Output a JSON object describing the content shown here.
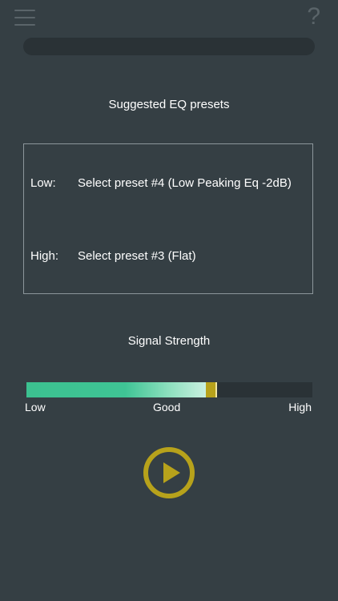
{
  "header": {
    "menu_icon": "hamburger-menu-icon",
    "help_label": "?"
  },
  "progress": {
    "value": 0
  },
  "eq": {
    "title": "Suggested EQ presets",
    "rows": [
      {
        "band": "Low:",
        "preset": "Select preset #4 (Low Peaking Eq -2dB)"
      },
      {
        "band": "High:",
        "preset": "Select preset #3 (Flat)"
      }
    ]
  },
  "signal": {
    "title": "Signal Strength",
    "level": 0.66,
    "labels": {
      "low": "Low",
      "good": "Good",
      "high": "High"
    }
  },
  "controls": {
    "play_icon": "play-icon"
  },
  "colors": {
    "background": "#353f44",
    "accent": "#b7a21b",
    "meter_fill": "#3cc190",
    "track": "#2a3236"
  }
}
